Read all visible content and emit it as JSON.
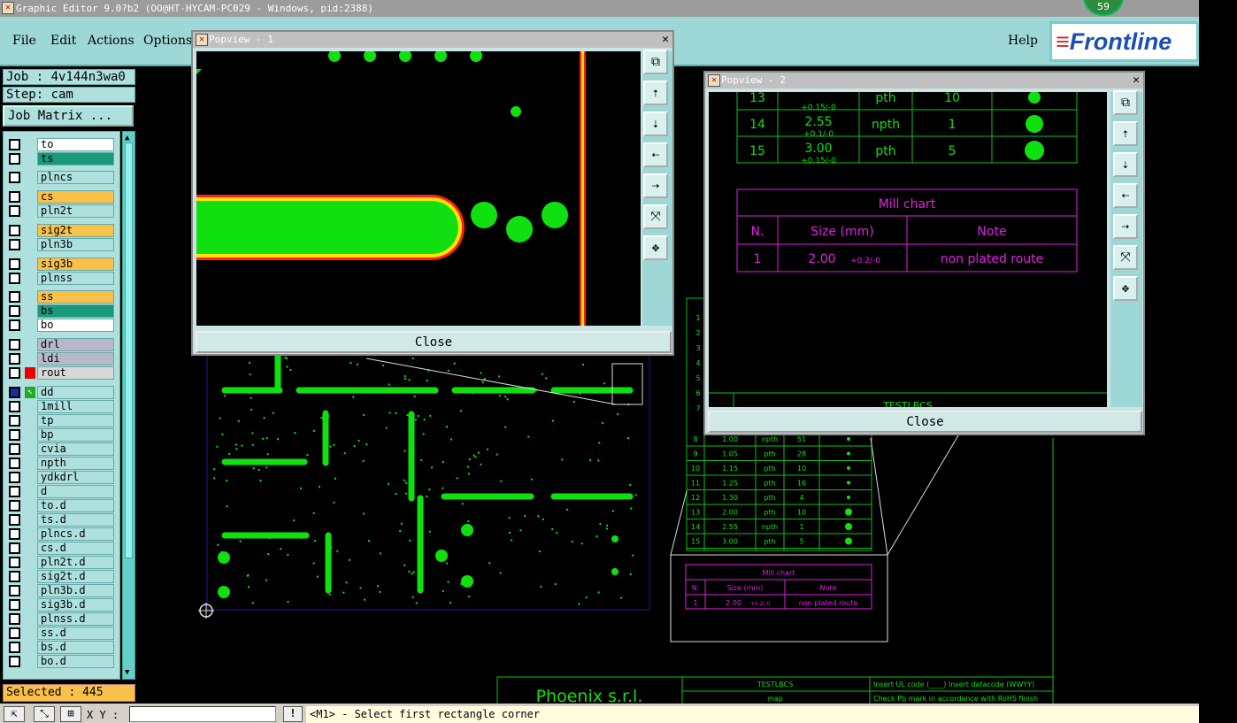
{
  "window": {
    "title": "Graphic Editor 9.0?b2 (OO@HT-HYCAM-PC029 - Windows, pid:2388)",
    "badge": "59"
  },
  "menu": {
    "file": "File",
    "edit": "Edit",
    "actions": "Actions",
    "options": "Options",
    "help": "Help",
    "logo": "Frontline"
  },
  "job": {
    "name": "Job : 4v144n3wa0",
    "step": "Step: cam",
    "matrix_button": "Job Matrix ..."
  },
  "layers": [
    "to",
    "ts",
    "plncs",
    "cs",
    "pln2t",
    "sig2t",
    "pln3b",
    "sig3b",
    "plnss",
    "ss",
    "bs",
    "bo",
    "drl",
    "ldi",
    "rout",
    "dd",
    "1mill",
    "tp",
    "bp",
    "cvia",
    "npth",
    "ydkdrl",
    "d",
    "to.d",
    "ts.d",
    "plncs.d",
    "cs.d",
    "pln2t.d",
    "sig2t.d",
    "pln3b.d",
    "sig3b.d",
    "plnss.d",
    "ss.d",
    "bs.d",
    "bo.d"
  ],
  "selected": "Selected : 445",
  "status": {
    "xy_label": "X Y :",
    "message": "<M1> - Select first rectangle corner"
  },
  "popview1": {
    "title": "Popview - 1",
    "close": "Close"
  },
  "popview2": {
    "title": "Popview - 2",
    "close": "Close",
    "drill_rows": [
      [
        "13",
        "",
        "+0.15/-0",
        "pth",
        "10"
      ],
      [
        "14",
        "2.55",
        "+0.1/-0",
        "npth",
        "1"
      ],
      [
        "15",
        "3.00",
        "+0.15/-0",
        "pth",
        "5"
      ]
    ],
    "mill_title": "Mill chart",
    "mill_headers": [
      "N.",
      "Size (mm)",
      "Note"
    ],
    "mill_row": [
      "1",
      "2.00",
      "+0.2/-0",
      "non plated route"
    ],
    "footer_partial": "TESTLBCS"
  },
  "canvas": {
    "drill_rows": [
      [
        "8",
        "1.00",
        "npth",
        "51"
      ],
      [
        "9",
        "1.05",
        "pth",
        "28"
      ],
      [
        "10",
        "1.15",
        "pth",
        "10"
      ],
      [
        "11",
        "1.25",
        "pth",
        "16"
      ],
      [
        "12",
        "1.30",
        "pth",
        "4"
      ],
      [
        "13",
        "2.00",
        "pth",
        "10"
      ],
      [
        "14",
        "2.55",
        "npth",
        "1"
      ],
      [
        "15",
        "3.00",
        "pth",
        "5"
      ]
    ],
    "mill_title": "Mill chart",
    "mill_headers": [
      "N.",
      "Size (mm)",
      "Note"
    ],
    "mill_row": [
      "1",
      "2.00",
      "+0.2/-0",
      "non plated route"
    ],
    "company": "Phoenix s.r.l.",
    "block_title": "TESTLBCS",
    "block_map": "map",
    "note1": "Insert UL code (____) Insert datacode (WWYY)",
    "note2": "Check Pb mark in accordance with RoHS finish"
  }
}
